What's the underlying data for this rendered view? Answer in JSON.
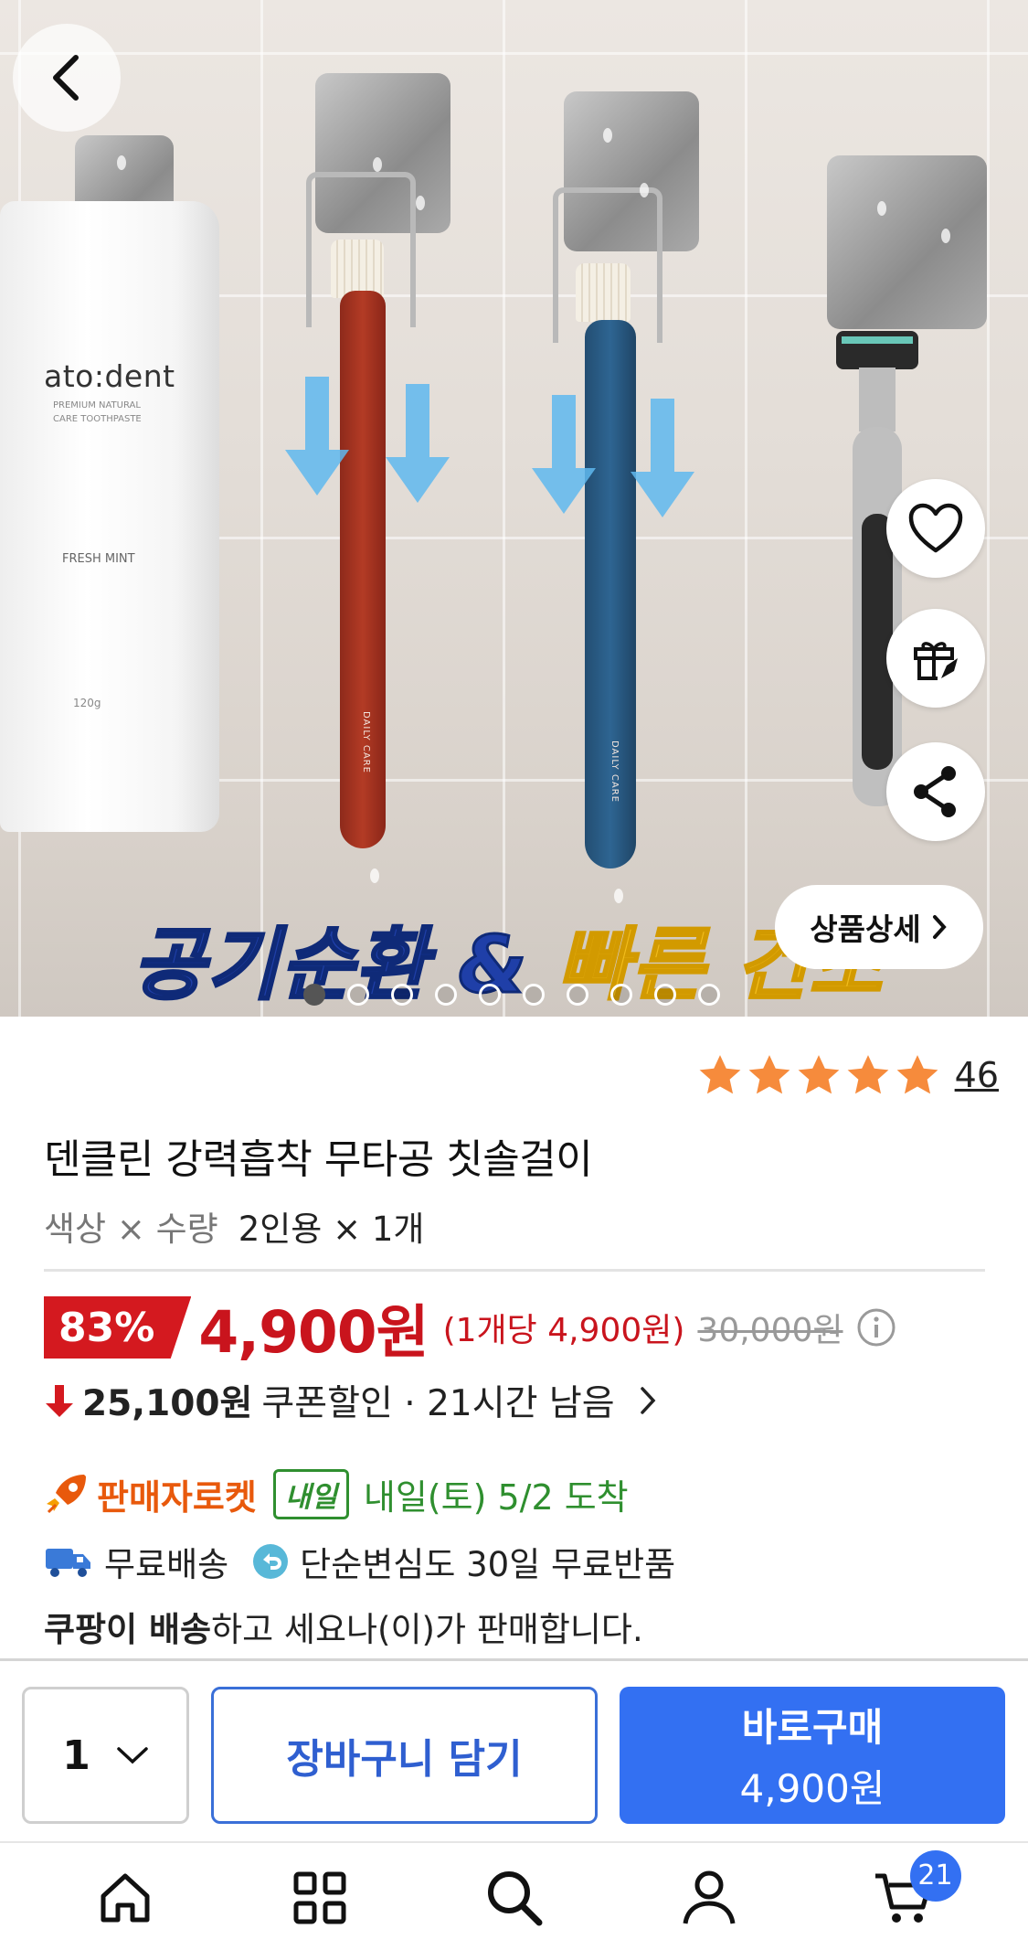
{
  "hero": {
    "caption_part1": "공기순환 &",
    "caption_part2": "빠른 건조",
    "tube_brand": "ato:dent",
    "tube_subtitle": "PREMIUM NATURAL CARE TOOTHPASTE",
    "tube_flavor": "FRESH MINT",
    "tube_weight": "120g",
    "brush_label": "DAILY CARE",
    "detail_button": "상품상세",
    "image_count": 10,
    "active_image": 1
  },
  "product": {
    "rating": 5,
    "review_count": "46",
    "title": "덴클린 강력흡착 무타공 칫솔걸이",
    "option_label": "색상 × 수량",
    "option_value": "2인용 × 1개"
  },
  "price": {
    "discount": "83%",
    "sale": "4,900원",
    "unit": "(1개당 4,900원)",
    "original": "30,000원",
    "coupon_amount": "25,100원",
    "coupon_text": "쿠폰할인 · 21시간 남음"
  },
  "shipping": {
    "rocket_label": "판매자로켓",
    "tomorrow_badge": "내일",
    "arrival": "내일(토) 5/2 도착",
    "free_shipping": "무료배송",
    "free_return": "단순변심도 30일 무료반품",
    "seller_bold": "쿠팡이 배송",
    "seller_rest": "하고 세요나(이)가 판매합니다."
  },
  "actions": {
    "quantity": "1",
    "cart_label": "장바구니 담기",
    "buy_label": "바로구매",
    "buy_price": "4,900원"
  },
  "tabbar": {
    "items": [
      "home-icon",
      "category-icon",
      "search-icon",
      "user-icon",
      "cart-icon"
    ],
    "cart_badge": "21"
  },
  "colors": {
    "accent": "#3370f2",
    "sale_red": "#c9141d",
    "star": "#f68b3c",
    "rocket_orange": "#e8590c",
    "green": "#2f8f2f"
  }
}
